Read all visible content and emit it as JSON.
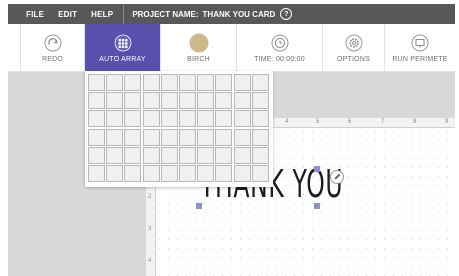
{
  "menubar": {
    "items": [
      "FILE",
      "EDIT",
      "HELP"
    ],
    "project_label": "PROJECT NAME:",
    "project_name": "THANK YOU CARD",
    "help_glyph": "?"
  },
  "toolbar": {
    "tools": [
      {
        "label": "REDO",
        "icon": "redo-icon"
      },
      {
        "label": "AUTO ARRAY",
        "icon": "grid-icon",
        "active": true
      },
      {
        "label": "BIRCH",
        "icon": "color-swatch",
        "color": "#cdb98c"
      },
      {
        "label": "TIME: 00:00:00",
        "icon": "clock-icon"
      },
      {
        "label": "OPTIONS",
        "icon": "gear-icon"
      },
      {
        "label": "RUN PERIMETE",
        "icon": "perimeter-icon"
      }
    ]
  },
  "ruler": {
    "top_ticks": [
      "4",
      "5",
      "6",
      "7",
      "8",
      "9"
    ],
    "left_ticks": [
      "2",
      "3",
      "4"
    ]
  },
  "canvas": {
    "text": "THANK YOU"
  },
  "auto_array": {
    "columns": 10,
    "rows": 6
  },
  "colors": {
    "menubar": "#58585a",
    "accent": "#5b4fae",
    "workspace": "#d8d8d8",
    "handle": "#8e8fd0"
  }
}
